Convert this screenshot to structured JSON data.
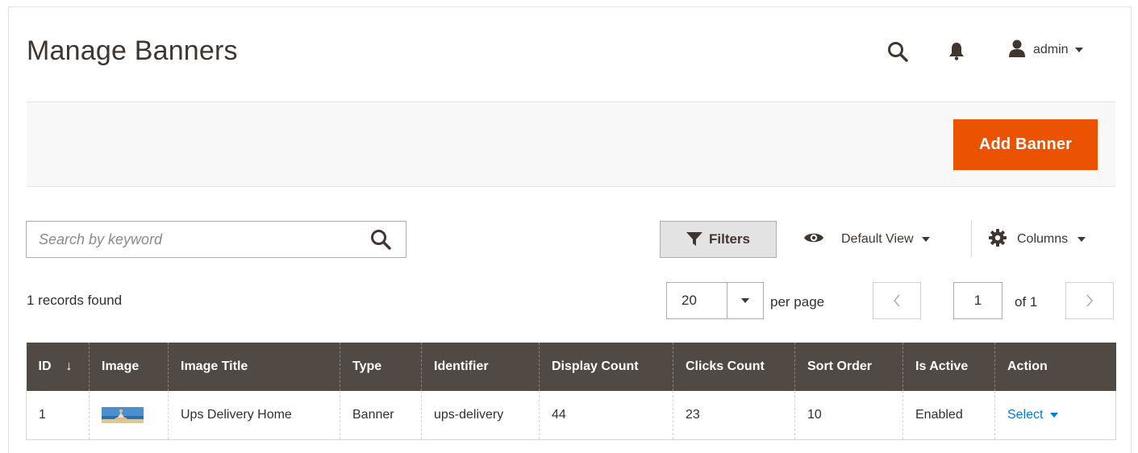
{
  "header": {
    "title": "Manage Banners",
    "user": "admin"
  },
  "actions": {
    "add_banner": "Add Banner"
  },
  "toolbar": {
    "search_placeholder": "Search by keyword",
    "filters": "Filters",
    "view": "Default View",
    "columns": "Columns"
  },
  "listing": {
    "records_found": "1 records found",
    "per_page_value": "20",
    "per_page_label": "per page",
    "current_page": "1",
    "page_total": "of 1"
  },
  "table": {
    "columns": [
      "ID",
      "Image",
      "Image Title",
      "Type",
      "Identifier",
      "Display Count",
      "Clicks Count",
      "Sort Order",
      "Is Active",
      "Action"
    ],
    "sort_indicator": "↓",
    "rows": [
      {
        "id": "1",
        "image_title": "Ups Delivery Home",
        "type": "Banner",
        "identifier": "ups-delivery",
        "display_count": "44",
        "clicks_count": "23",
        "sort_order": "10",
        "is_active": "Enabled",
        "action": "Select"
      }
    ]
  },
  "colors": {
    "accent": "#eb5202",
    "table_header": "#514943",
    "link": "#007bdb",
    "title": "#41362f"
  },
  "icons": {
    "header_search": "search-icon",
    "notifications": "bell-icon",
    "user": "user-icon",
    "filters": "funnel-icon",
    "view": "eye-icon",
    "columns": "gear-icon",
    "prev": "chevron-left-icon",
    "next": "chevron-right-icon"
  }
}
